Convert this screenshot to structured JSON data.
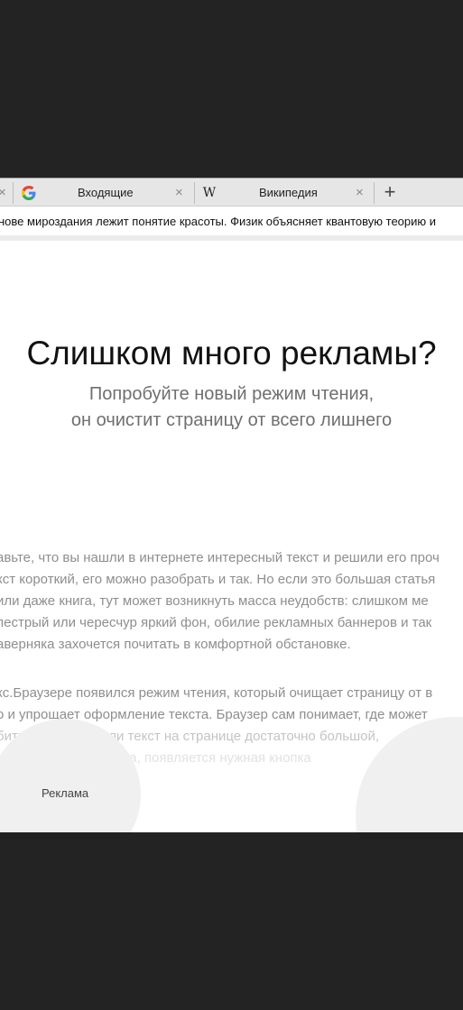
{
  "tabs": [
    {
      "title": "Входящие",
      "favicon": "google-g-icon"
    },
    {
      "title": "Википедия",
      "favicon": "wikipedia-w-icon"
    }
  ],
  "pagebar": {
    "text": "нове мироздания лежит понятие красоты. Физик объясняет квантовую теорию и"
  },
  "promo": {
    "headline": "Слишком много рекламы?",
    "subline_1": "Попробуйте новый режим чтения,",
    "subline_2": "он очистит страницу от всего лишнего"
  },
  "article": {
    "lines_1": [
      "авьте, что вы нашли в интернете интересный текст и решили его проч",
      "кст короткий, его можно разобрать и так. Но если это большая статья",
      " или даже книга, тут может возникнуть масса неудобств: слишком ме",
      " пестрый или чересчур яркий фон, обилие рекламных баннеров и так",
      "аверняка захочется почитать в комфортной обстановке."
    ],
    "lines_2": [
      "кс.Браузере появился режим чтения, который очищает страницу от в",
      "о и упрощает оформление текста. Браузер сам понимает, где может",
      "бить          ким. Если текст на странице достаточно большой, ",
      "               адреса сайта, появляется нужная кнопка"
    ]
  },
  "ad": {
    "label": "Реклама"
  },
  "colors": {
    "background": "#232323",
    "tabbar": "#e6e6e6",
    "circle": "#f0f0f0"
  }
}
